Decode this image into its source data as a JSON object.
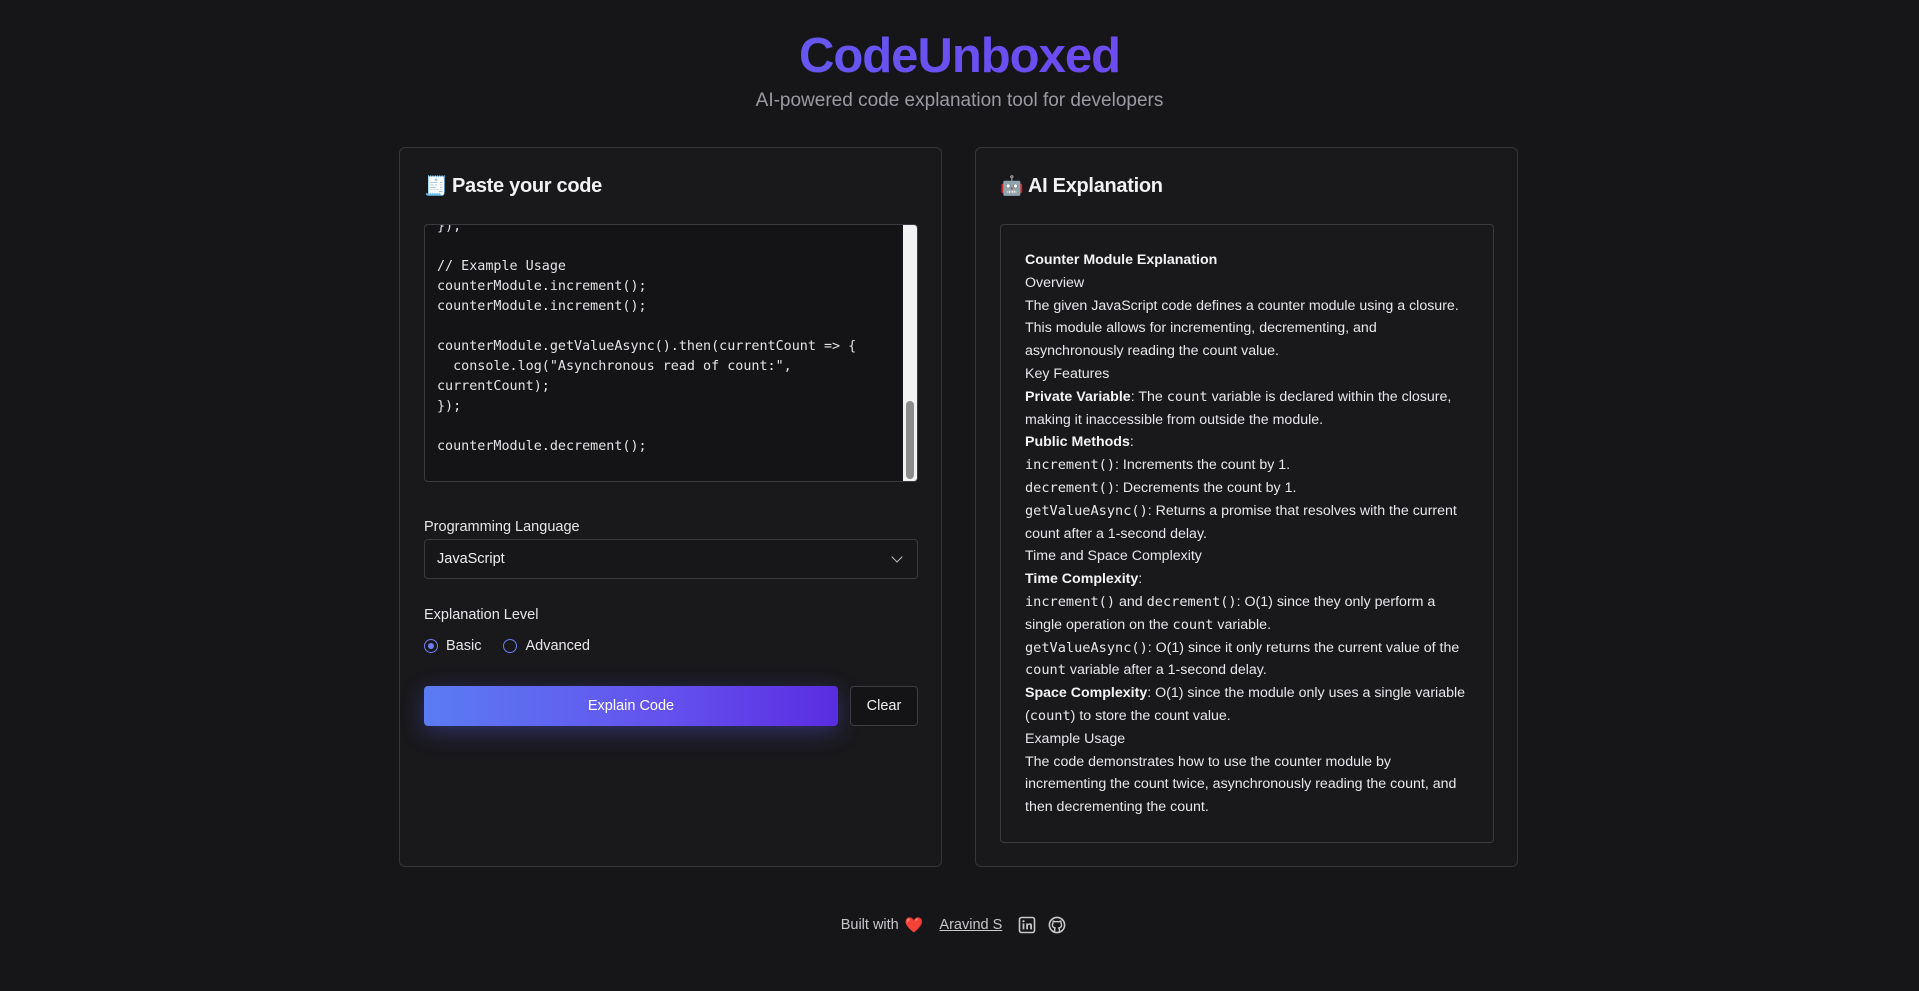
{
  "header": {
    "title": "CodeUnboxed",
    "subtitle": "AI-powered code explanation tool for developers",
    "title_gradient": [
      "#5b78f2",
      "#7b3fe4"
    ]
  },
  "left_panel": {
    "title_icon": "🧾",
    "title": "Paste your code",
    "code": "});\n\n// Example Usage\ncounterModule.increment();\ncounterModule.increment();\n\ncounterModule.getValueAsync().then(currentCount => {\n  console.log(\"Asynchronous read of count:\",\ncurrentCount);\n});\n\ncounterModule.decrement();",
    "language_label": "Programming Language",
    "language_value": "JavaScript",
    "level_label": "Explanation Level",
    "level_options": [
      "Basic",
      "Advanced"
    ],
    "level_selected": "Basic",
    "explain_button": "Explain Code",
    "clear_button": "Clear",
    "accent_color": "#6450ee"
  },
  "right_panel": {
    "title_icon": "🤖",
    "title": "AI Explanation",
    "explanation": {
      "heading": "Counter Module Explanation",
      "overview_label": "Overview",
      "overview_text": "The given JavaScript code defines a counter module using a closure. This module allows for incrementing, decrementing, and asynchronously reading the count value.",
      "features_label": "Key Features",
      "private_label": "Private Variable",
      "private_text_1": ": The ",
      "private_code": "count",
      "private_text_2": " variable is declared within the closure, making it inaccessible from outside the module.",
      "public_label": "Public Methods",
      "colon": ":",
      "m1_code": "increment()",
      "m1_text": ": Increments the count by 1.",
      "m2_code": "decrement()",
      "m2_text": ": Decrements the count by 1.",
      "m3_code": "getValueAsync()",
      "m3_text": ": Returns a promise that resolves with the current count after a 1-second delay.",
      "complexity_label": "Time and Space Complexity",
      "time_label": "Time Complexity",
      "t1_code_a": "increment()",
      "t1_and": " and ",
      "t1_code_b": "decrement()",
      "t1_text_1": ": O(1) since they only perform a single operation on the ",
      "t1_code_c": "count",
      "t1_text_2": " variable.",
      "t2_code": "getValueAsync()",
      "t2_text_1": ": O(1) since it only returns the current value of the ",
      "t2_code_b": "count",
      "t2_text_2": " variable after a 1-second delay.",
      "space_label": "Space Complexity",
      "space_text_1": ": O(1) since the module only uses a single variable (",
      "space_code": "count",
      "space_text_2": ") to store the count value.",
      "usage_label": "Example Usage",
      "usage_text": "The code demonstrates how to use the counter module by incrementing the count twice, asynchronously reading the count, and then decrementing the count."
    }
  },
  "footer": {
    "built_with": "Built with",
    "heart": "❤️",
    "author": "Aravind S",
    "icons": [
      "linkedin-icon",
      "github-icon"
    ]
  }
}
